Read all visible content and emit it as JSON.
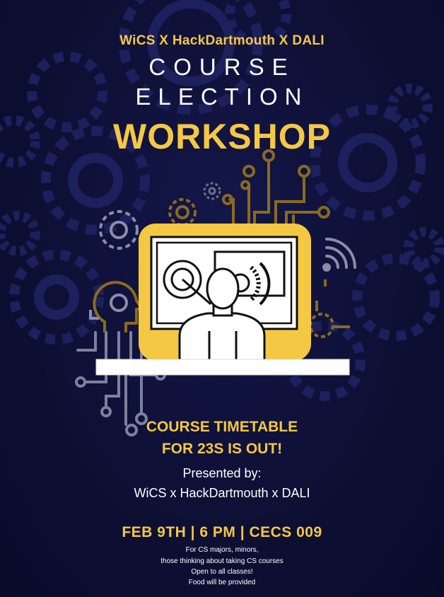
{
  "header": {
    "organizers": "WiCS X HackDartmouth X DALI",
    "line1": "COURSE",
    "line2": "ELECTION",
    "line3": "WORKSHOP"
  },
  "announcement": {
    "line1": "COURSE TIMETABLE",
    "line2": "FOR 23S IS OUT!"
  },
  "presenters": {
    "label": "Presented by:",
    "names": "WiCS x HackDartmouth x DALI"
  },
  "event": {
    "details": "FEB 9TH | 6 PM | CECS 009"
  },
  "notes": [
    "For CS majors, minors,",
    "those thinking about taking CS courses",
    "Open to all classes!",
    "Food will be provided"
  ],
  "colors": {
    "background": "#0d0f33",
    "accent": "#f4c842",
    "text": "#ffffff"
  },
  "icons": [
    "gear-icon",
    "circuit-icon",
    "wifi-icon",
    "brain-head-icon",
    "person-at-computer-illustration"
  ]
}
